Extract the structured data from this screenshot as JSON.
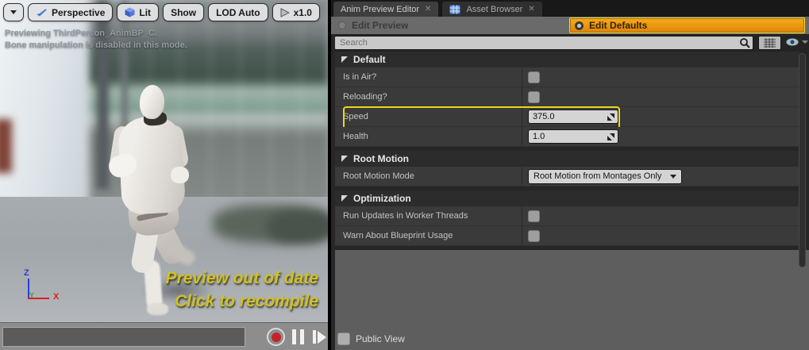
{
  "icons": {
    "close": "✕"
  },
  "viewport": {
    "toolbar": {
      "perspective": "Perspective",
      "lit": "Lit",
      "show": "Show",
      "lod": "LOD Auto",
      "playback_speed": "x1.0"
    },
    "info_line1": "Previewing ThirdPerson_AnimBP_C.",
    "info_line2": "Bone manipulation is disabled in this mode.",
    "overlay_line1": "Preview out of date",
    "overlay_line2": "Click to recompile",
    "axis": {
      "x": "X",
      "y": "Y",
      "z": "Z"
    }
  },
  "panel": {
    "tabs": [
      {
        "label": "Anim Preview Editor"
      },
      {
        "label": "Asset Browser"
      }
    ],
    "mode": {
      "edit_preview": "Edit Preview",
      "edit_defaults": "Edit Defaults"
    },
    "search": {
      "placeholder": "Search"
    },
    "sections": [
      {
        "title": "Default",
        "rows": [
          {
            "label": "Is in Air?",
            "control": "checkbox",
            "checked": false
          },
          {
            "label": "Reloading?",
            "control": "checkbox",
            "checked": false
          },
          {
            "label": "Speed",
            "control": "number",
            "value": "375.0",
            "highlighted": true
          },
          {
            "label": "Health",
            "control": "number",
            "value": "1.0",
            "highlighted": false
          }
        ]
      },
      {
        "title": "Root Motion",
        "rows": [
          {
            "label": "Root Motion Mode",
            "control": "dropdown",
            "value": "Root Motion from Montages Only"
          }
        ]
      },
      {
        "title": "Optimization",
        "rows": [
          {
            "label": "Run Updates in Worker Threads",
            "control": "checkbox",
            "checked": false
          },
          {
            "label": "Warn About Blueprint Usage",
            "control": "checkbox",
            "checked": false
          }
        ]
      }
    ],
    "footer": {
      "public_view": "Public View"
    }
  },
  "colors": {
    "edit_defaults_orange": "#E8930D",
    "highlight_yellow": "#EBD71F",
    "overlay_warning_yellow": "#CFC02B"
  }
}
